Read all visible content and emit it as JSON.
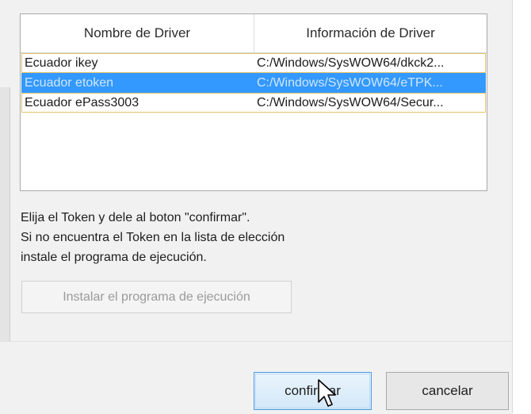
{
  "driver_list": {
    "columns": [
      "Nombre de Driver",
      "Información de Driver"
    ],
    "rows": [
      {
        "name": "Ecuador ikey",
        "info": "C:/Windows/SysWOW64/dkck2..."
      },
      {
        "name": "Ecuador etoken",
        "info": "C:/Windows/SysWOW64/eTPK...",
        "selected": true
      },
      {
        "name": "Ecuador ePass3003",
        "info": "C:/Windows/SysWOW64/Secur..."
      }
    ]
  },
  "instructions": {
    "line1": "Elija el Token y dele al boton \"confirmar\".",
    "line2": "Si no encuentra el Token en la lista de elección",
    "line3": "instale el programa de ejecución."
  },
  "buttons": {
    "install_label": "Instalar el programa de ejecución",
    "confirm_label": "confirmar",
    "cancel_label": "cancelar"
  },
  "colors": {
    "selection": "#3399ff",
    "focus_outline": "#e3c46b",
    "default_button_border": "#4d9be0"
  },
  "icons": {
    "cursor": "arrow-pointer-icon"
  }
}
